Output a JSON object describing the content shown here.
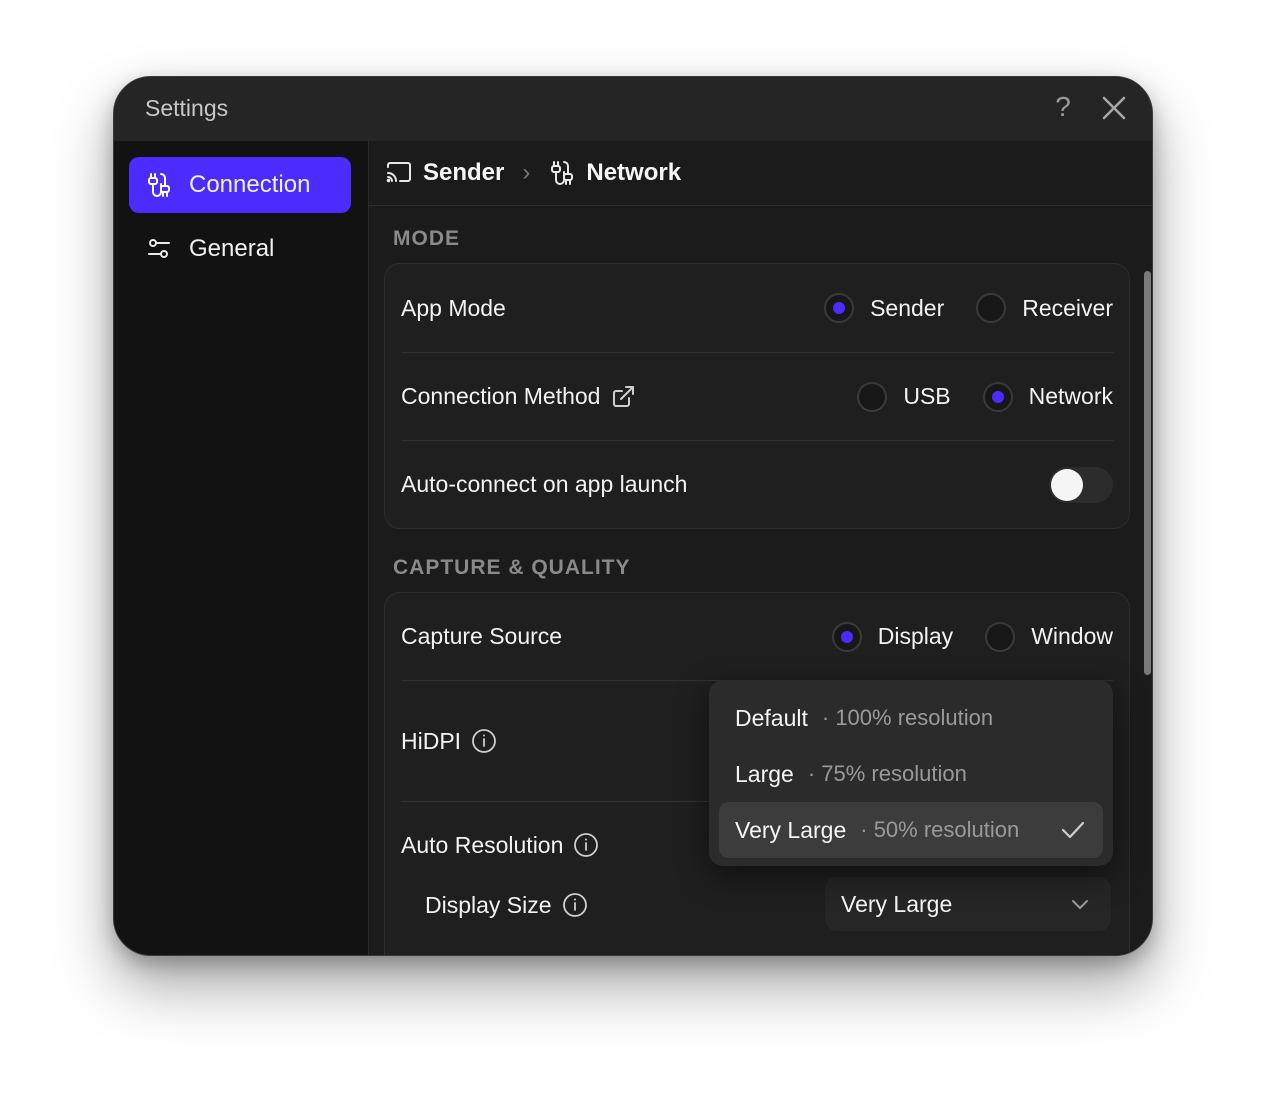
{
  "window": {
    "title": "Settings"
  },
  "sidebar": {
    "items": [
      {
        "label": "Connection",
        "icon": "cable-icon",
        "active": true
      },
      {
        "label": "General",
        "icon": "sliders-icon",
        "active": false
      }
    ]
  },
  "breadcrumb": {
    "items": [
      {
        "label": "Sender",
        "icon": "cast-icon"
      },
      {
        "label": "Network",
        "icon": "cable-icon"
      }
    ],
    "separator": "›"
  },
  "sections": {
    "mode": {
      "label": "MODE",
      "app_mode": {
        "label": "App Mode",
        "options": [
          "Sender",
          "Receiver"
        ],
        "selected": "Sender"
      },
      "connection_method": {
        "label": "Connection Method",
        "options": [
          "USB",
          "Network"
        ],
        "selected": "Network"
      },
      "auto_connect": {
        "label": "Auto-connect on app launch",
        "enabled": false
      }
    },
    "capture": {
      "label": "CAPTURE & QUALITY",
      "capture_source": {
        "label": "Capture Source",
        "options": [
          "Display",
          "Window"
        ],
        "selected": "Display"
      },
      "hidpi": {
        "label": "HiDPI"
      },
      "auto_resolution": {
        "label": "Auto Resolution"
      },
      "display_size": {
        "label": "Display Size",
        "value": "Very Large"
      }
    }
  },
  "dropdown": {
    "items": [
      {
        "label": "Default",
        "detail": "· 100% resolution",
        "selected": false
      },
      {
        "label": "Large",
        "detail": "· 75% resolution",
        "selected": false
      },
      {
        "label": "Very Large",
        "detail": "· 50% resolution",
        "selected": true
      }
    ]
  },
  "colors": {
    "accent": "#4b2bff",
    "window_bg": "#1b1b1b",
    "sidebar_bg": "#121212",
    "titlebar_bg": "#252525"
  },
  "icons": {
    "help": "?",
    "close": "close-icon"
  }
}
